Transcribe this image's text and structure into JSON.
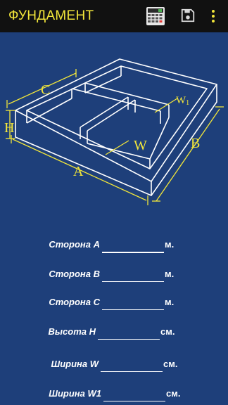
{
  "appbar": {
    "title": "ФУНДАМЕНТ",
    "icons": [
      "calculator-icon",
      "save-icon",
      "more-vert-icon"
    ],
    "accent_color": "#f2e63a",
    "background_color": "#111111"
  },
  "diagram": {
    "labels": {
      "a": "A",
      "b": "B",
      "c": "C",
      "h": "H",
      "w": "W",
      "w1": "W",
      "w1_sub": "1"
    },
    "line_color": "#ffffff",
    "dimension_color": "#f2e63a"
  },
  "form": {
    "fields": [
      {
        "label": "Сторона A",
        "value": "",
        "unit": "м."
      },
      {
        "label": "Сторона B",
        "value": "",
        "unit": "м."
      },
      {
        "label": "Сторона C",
        "value": "",
        "unit": "м."
      },
      {
        "label": "Высота H",
        "value": "",
        "unit": "см."
      },
      {
        "label": "Ширина W",
        "value": "",
        "unit": "см."
      },
      {
        "label": "Ширина W1",
        "value": "",
        "unit": "см."
      }
    ]
  },
  "background_color": "#1e3f7a"
}
